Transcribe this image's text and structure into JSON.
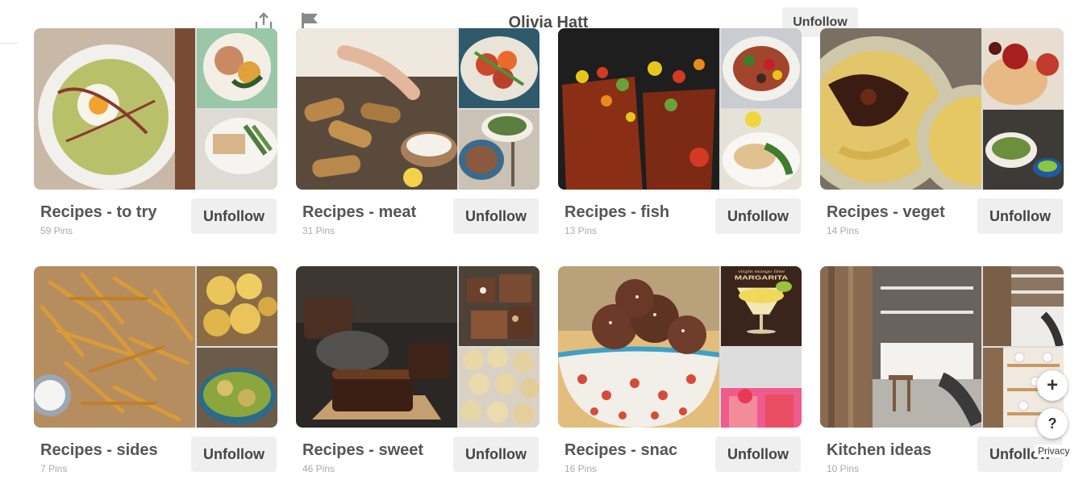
{
  "header": {
    "user_name": "Olivia Hatt",
    "unfollow_label": "Unfollow"
  },
  "boards": [
    {
      "title": "Recipes - to try",
      "pins": "59 Pins",
      "unfollow_label": "Unfollow"
    },
    {
      "title": "Recipes - meat",
      "pins": "31 Pins",
      "unfollow_label": "Unfollow"
    },
    {
      "title": "Recipes - fish",
      "pins": "13 Pins",
      "unfollow_label": "Unfollow"
    },
    {
      "title": "Recipes - veget",
      "pins": "14 Pins",
      "unfollow_label": "Unfollow"
    },
    {
      "title": "Recipes - sides",
      "pins": "7 Pins",
      "unfollow_label": "Unfollow"
    },
    {
      "title": "Recipes - sweet",
      "pins": "46 Pins",
      "unfollow_label": "Unfollow"
    },
    {
      "title": "Recipes - snac",
      "pins": "16 Pins",
      "unfollow_label": "Unfollow"
    },
    {
      "title": "Kitchen ideas",
      "pins": "10 Pins",
      "unfollow_label": "Unfollow"
    }
  ],
  "photo_text": {
    "margarita_brand": "virgin mango lime",
    "margarita_name": "MARGARITA"
  },
  "floating": {
    "plus_label": "+",
    "help_label": "?",
    "privacy_label": "Privacy"
  }
}
